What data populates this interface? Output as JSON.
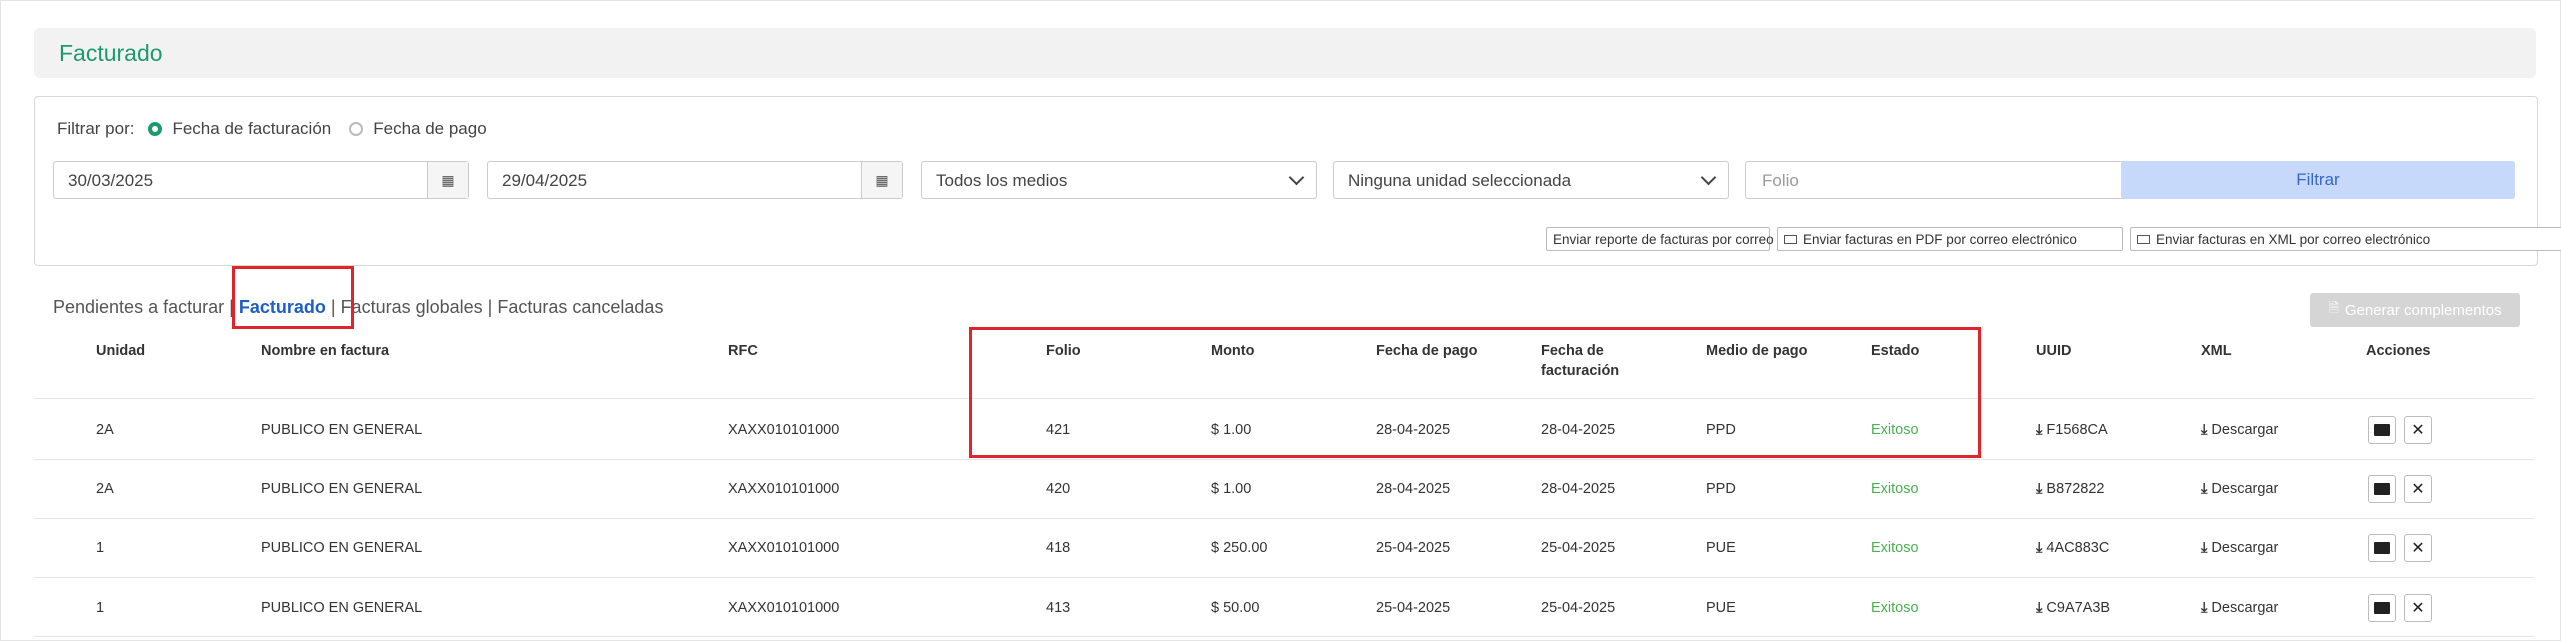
{
  "page": {
    "title": "Facturado"
  },
  "filter": {
    "label": "Filtrar por:",
    "options": [
      "Fecha de facturación",
      "Fecha de pago"
    ],
    "date_from": "30/03/2025",
    "date_to": "29/04/2025",
    "medios": "Todos los medios",
    "unidad": "Ninguna unidad seleccionada",
    "folio_placeholder": "Folio",
    "filter_button": "Filtrar"
  },
  "send_buttons": {
    "report": "Enviar reporte de facturas por correo",
    "pdf": "Enviar facturas en PDF por correo electrónico",
    "xml": "Enviar facturas en XML por correo electrónico"
  },
  "tabs": {
    "pendientes": "Pendientes a facturar",
    "facturado": "Facturado",
    "globales": "Facturas globales",
    "canceladas": "Facturas canceladas",
    "sep": "|"
  },
  "generate_button": "Generar complementos",
  "table": {
    "headers": {
      "unidad": "Unidad",
      "nombre": "Nombre en factura",
      "rfc": "RFC",
      "folio": "Folio",
      "monto": "Monto",
      "fecha_pago": "Fecha de pago",
      "fecha_fact_1": "Fecha de",
      "fecha_fact_2": "facturación",
      "medio": "Medio de pago",
      "estado": "Estado",
      "uuid": "UUID",
      "xml": "XML",
      "acciones": "Acciones"
    },
    "rows": [
      {
        "unidad": "2A",
        "nombre": "PUBLICO EN GENERAL",
        "rfc": "XAXX010101000",
        "folio": "421",
        "monto": "$ 1.00",
        "fecha_pago": "28-04-2025",
        "fecha_fact": "28-04-2025",
        "medio": "PPD",
        "estado": "Exitoso",
        "uuid": "F1568CA",
        "xml": "Descargar"
      },
      {
        "unidad": "2A",
        "nombre": "PUBLICO EN GENERAL",
        "rfc": "XAXX010101000",
        "folio": "420",
        "monto": "$ 1.00",
        "fecha_pago": "28-04-2025",
        "fecha_fact": "28-04-2025",
        "medio": "PPD",
        "estado": "Exitoso",
        "uuid": "B872822",
        "xml": "Descargar"
      },
      {
        "unidad": "1",
        "nombre": "PUBLICO EN GENERAL",
        "rfc": "XAXX010101000",
        "folio": "418",
        "monto": "$ 250.00",
        "fecha_pago": "25-04-2025",
        "fecha_fact": "25-04-2025",
        "medio": "PUE",
        "estado": "Exitoso",
        "uuid": "4AC883C",
        "xml": "Descargar"
      },
      {
        "unidad": "1",
        "nombre": "PUBLICO EN GENERAL",
        "rfc": "XAXX010101000",
        "folio": "413",
        "monto": "$ 50.00",
        "fecha_pago": "25-04-2025",
        "fecha_fact": "25-04-2025",
        "medio": "PUE",
        "estado": "Exitoso",
        "uuid": "C9A7A3B",
        "xml": "Descargar"
      }
    ]
  },
  "colors": {
    "accent": "#1c9a6e",
    "link": "#1e5fc7",
    "success": "#4caf50",
    "highlight": "#e0242a"
  }
}
